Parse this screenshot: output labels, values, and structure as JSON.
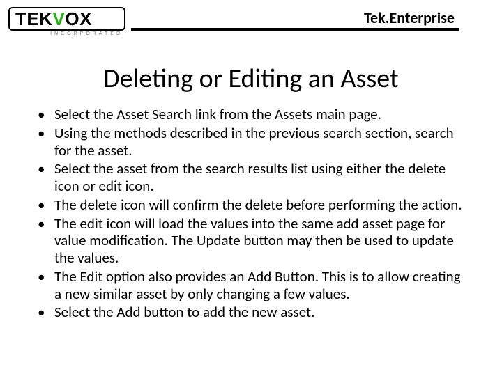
{
  "header": {
    "logo": {
      "part1": "TEK",
      "part2": "V",
      "part3": "OX",
      "sub": "INCORPORATED"
    },
    "product": "Tek.Enterprise"
  },
  "title": "Deleting or Editing an Asset",
  "bullets": [
    "Select the Asset Search link from the Assets main page.",
    "Using the methods described in the previous search section, search for the asset.",
    "Select the asset from the search results list using either the delete icon or edit icon.",
    "The delete icon will confirm the delete before performing the action.",
    "The edit icon will load the values into the same add asset page for value modification. The Update button may then be used to update the values.",
    "The Edit option also provides an Add Button. This is to allow creating a new similar asset by only changing a few values.",
    "Select the Add button to add the new asset."
  ]
}
